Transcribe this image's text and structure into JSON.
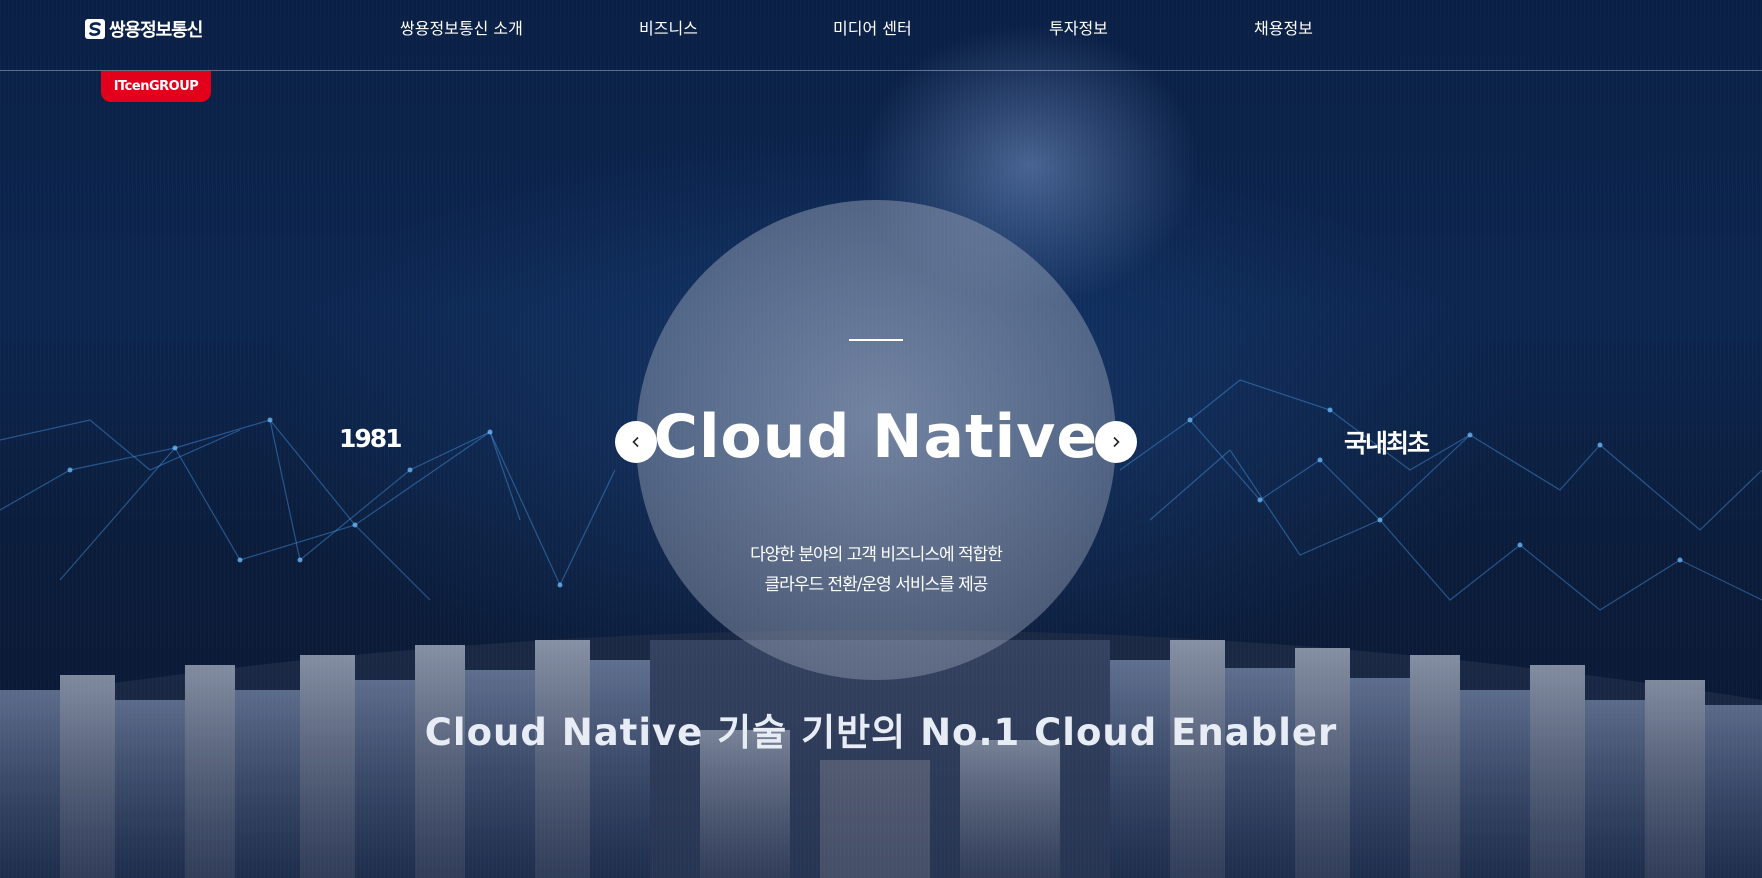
{
  "header": {
    "logo_text": "쌍용정보통신",
    "nav": [
      {
        "label": "쌍용정보통신 소개"
      },
      {
        "label": "비즈니스"
      },
      {
        "label": "미디어 센터"
      },
      {
        "label": "투자정보"
      },
      {
        "label": "채용정보"
      }
    ]
  },
  "group_badge": "ITcenGROUP",
  "slider": {
    "prev_label": "1981",
    "next_label": "국내최초",
    "title": "Cloud Native",
    "description_line1": "다양한 분야의 고객 비즈니스에 적합한",
    "description_line2": "클라우드 전환/운영 서비스를 제공",
    "prev_icon": "chevron-left-icon",
    "next_icon": "chevron-right-icon"
  },
  "tagline": "Cloud Native 기술 기반의 No.1 Cloud Enabler",
  "colors": {
    "background": "#0b2350",
    "badge": "#e3001b",
    "text": "#ffffff"
  }
}
